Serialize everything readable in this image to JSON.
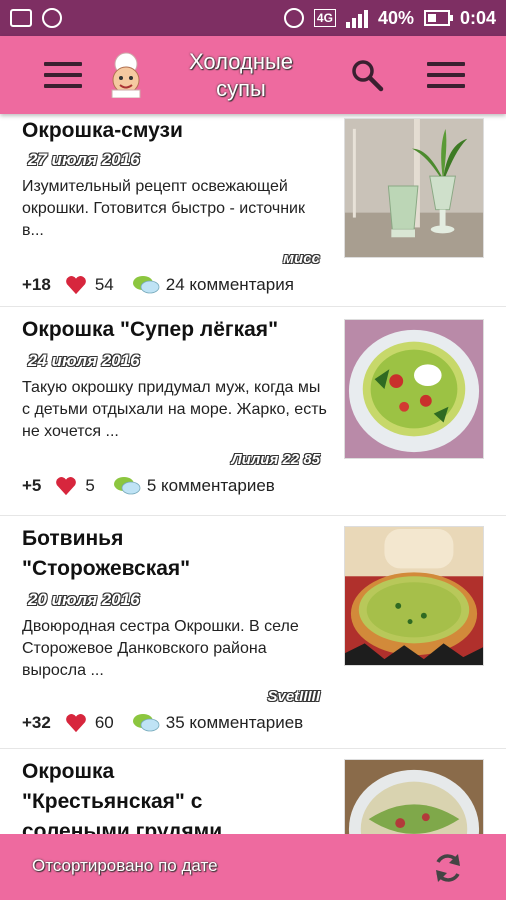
{
  "status_bar": {
    "battery_percent": "40%",
    "time": "0:04",
    "network": "4G",
    "icons": [
      "image-icon",
      "sync-icon",
      "alarm-icon",
      "signal-icon",
      "battery-charging-icon"
    ]
  },
  "app_bar": {
    "title": "Холодные супы",
    "icons": [
      "menu-icon",
      "chef-logo",
      "search-icon",
      "menu-icon"
    ]
  },
  "feed": {
    "items": [
      {
        "title": "Окрошка-смузи",
        "date": "27 июля 2016",
        "description": "Изумительный рецепт освежающей окрошки. Готовится быстро - источник в...",
        "author": "мисс",
        "score": "+18",
        "likes": "54",
        "comments": "24 комментария"
      },
      {
        "title": "Окрошка \"Супер лёгкая\"",
        "date": "24 июля 2016",
        "description": "Такую окрошку придумал муж, когда мы с детьми отдыхали на море. Жарко, есть не хочется ...",
        "author": "Лилия 22 85",
        "score": "+5",
        "likes": "5",
        "comments": "5 комментариев"
      },
      {
        "title": "Ботвинья \"Сторожевская\"",
        "date": "20 июля 2016",
        "description": "Двоюродная сестра Окрошки. В селе Сторожевое Данковского района выросла ...",
        "author": "SvetIIIII",
        "score": "+32",
        "likes": "60",
        "comments": "35 комментариев"
      },
      {
        "title": "Окрошка \"Крестьянская\" с солеными грудями"
      }
    ]
  },
  "bottom_bar": {
    "sort_label": "Отсортировано по дате",
    "icon": "refresh-icon"
  },
  "colors": {
    "status_bar": "#7e2f63",
    "app_bar": "#ee6a9f",
    "heart": "#d7263d"
  }
}
